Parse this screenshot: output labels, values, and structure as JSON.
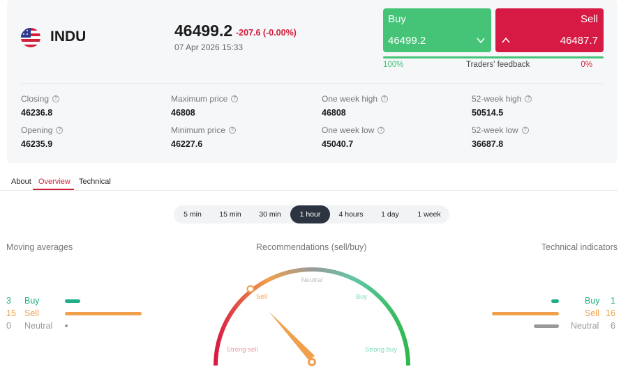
{
  "instrument": {
    "symbol": "INDU",
    "flag_icon": "us-flag-icon",
    "price": "46499.2",
    "change": "-207.6 (-0.00%)",
    "datetime": "07 Apr 2026 15:33"
  },
  "trade": {
    "buy_label": "Buy",
    "buy_price": "46499.2",
    "sell_label": "Sell",
    "sell_price": "46487.7",
    "buy_color": "#45c477",
    "sell_color": "#d71a44"
  },
  "feedback": {
    "buy_percent": "100%",
    "label": "Traders' feedback",
    "sell_percent": "0%",
    "buy_fraction": 1.0
  },
  "stats": [
    {
      "label": "Closing",
      "value": "46236.8"
    },
    {
      "label": "Maximum price",
      "value": "46808"
    },
    {
      "label": "One week high",
      "value": "46808"
    },
    {
      "label": "52-week high",
      "value": "50514.5"
    },
    {
      "label": "Opening",
      "value": "46235.9"
    },
    {
      "label": "Minimum price",
      "value": "46227.6"
    },
    {
      "label": "One week low",
      "value": "45040.7"
    },
    {
      "label": "52-week low",
      "value": "36687.8"
    }
  ],
  "tabs": [
    {
      "label": "About"
    },
    {
      "label": "Overview",
      "active": true
    },
    {
      "label": "Technical"
    }
  ],
  "periods": [
    {
      "label": "5 min"
    },
    {
      "label": "15 min"
    },
    {
      "label": "30 min"
    },
    {
      "label": "1 hour",
      "active": true
    },
    {
      "label": "4 hours"
    },
    {
      "label": "1 day"
    },
    {
      "label": "1 week"
    }
  ],
  "moving_averages": {
    "title": "Moving averages",
    "rows": [
      {
        "count": "3",
        "label": "Buy",
        "value": 3,
        "color": "#1fae87"
      },
      {
        "count": "15",
        "label": "Sell",
        "value": 15,
        "color": "#f0a04b"
      },
      {
        "count": "0",
        "label": "Neutral",
        "value": 0,
        "color": "#999999"
      }
    ]
  },
  "recommendations": {
    "title": "Recommendations (sell/buy)",
    "labels": {
      "strong_sell": "Strong sell",
      "sell": "Sell",
      "neutral": "Neutral",
      "buy": "Buy",
      "strong_buy": "Strong buy"
    },
    "active_label": "sell",
    "needle_color": "#f0a04b"
  },
  "technical_indicators": {
    "title": "Technical indicators",
    "rows": [
      {
        "count": "1",
        "label": "Buy",
        "value": 1,
        "color": "#1fae87"
      },
      {
        "count": "16",
        "label": "Sell",
        "value": 16,
        "color": "#f0a04b"
      },
      {
        "count": "6",
        "label": "Neutral",
        "value": 6,
        "color": "#999999"
      }
    ]
  }
}
